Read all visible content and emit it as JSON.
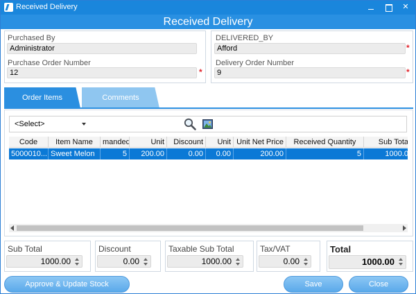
{
  "window": {
    "title": "Received Delivery",
    "header": "Received Delivery"
  },
  "left_panel": {
    "purchased_by_label": "Purchased By",
    "purchased_by_value": "Administrator",
    "po_number_label": "Purchase Order Number",
    "po_number_value": "12",
    "required_mark": "*"
  },
  "right_panel": {
    "delivered_by_label": "DELIVERED_BY",
    "delivered_by_value": "Afford",
    "do_number_label": "Delivery Order Number",
    "do_number_value": "9",
    "required_mark": "*"
  },
  "tabs": [
    {
      "label": "Order Items",
      "active": true
    },
    {
      "label": "Comments",
      "active": false
    }
  ],
  "toolbar": {
    "select_value": "<Select>"
  },
  "table": {
    "columns": [
      "Code",
      "Item Name",
      "manded",
      "Unit",
      "Discount",
      "Unit",
      "Unit Net Price",
      "Received Quantity",
      "Sub Tota"
    ],
    "rows": [
      [
        "5000010...",
        "Sweet Melon",
        "5",
        "200.00",
        "0.00",
        "0.00",
        "200.00",
        "5",
        "1000.0"
      ]
    ]
  },
  "totals": {
    "sub_total_label": "Sub Total",
    "sub_total_value": "1000.00",
    "discount_label": "Discount",
    "discount_value": "0.00",
    "taxable_label": "Taxable Sub Total",
    "taxable_value": "1000.00",
    "tax_label": "Tax/VAT",
    "tax_value": "0.00",
    "total_label": "Total",
    "total_value": "1000.00"
  },
  "buttons": {
    "approve": "Approve & Update Stock",
    "save": "Save",
    "close": "Close"
  },
  "colors": {
    "title_bar": "#1a86dc",
    "header": "#2990e2",
    "selected_row": "#0b79d6",
    "required": "#e0252d"
  }
}
